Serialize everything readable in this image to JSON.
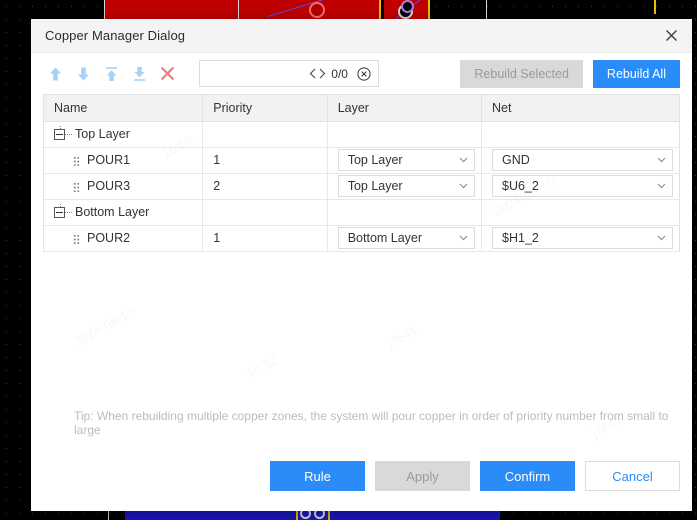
{
  "dialog": {
    "title": "Copper Manager Dialog",
    "close_icon": "close-icon"
  },
  "toolbar": {
    "icons": [
      {
        "name": "move-up-icon",
        "tooltip": "Move Up"
      },
      {
        "name": "move-down-icon",
        "tooltip": "Move Down"
      },
      {
        "name": "move-to-top-icon",
        "tooltip": "Move To Top"
      },
      {
        "name": "move-to-bottom-icon",
        "tooltip": "Move To Bottom"
      },
      {
        "name": "delete-icon",
        "tooltip": "Delete"
      }
    ],
    "search": {
      "value": "",
      "placeholder": "",
      "counter": "0/0",
      "prev_icon": "chevron-left-icon",
      "next_icon": "chevron-right-icon",
      "clear_icon": "clear-circle-icon"
    },
    "rebuild_selected_label": "Rebuild Selected",
    "rebuild_all_label": "Rebuild All"
  },
  "table": {
    "columns": [
      "Name",
      "Priority",
      "Layer",
      "Net"
    ],
    "groups": [
      {
        "name": "Top Layer",
        "expanded": true,
        "rows": [
          {
            "name": "POUR1",
            "priority": "1",
            "layer": "Top Layer",
            "net": "GND"
          },
          {
            "name": "POUR3",
            "priority": "2",
            "layer": "Top Layer",
            "net": "$U6_2"
          }
        ]
      },
      {
        "name": "Bottom Layer",
        "expanded": true,
        "rows": [
          {
            "name": "POUR2",
            "priority": "1",
            "layer": "Bottom Layer",
            "net": "$H1_2"
          }
        ]
      }
    ]
  },
  "tip": "Tip: When rebuilding multiple copper zones, the system will pour copper in order of priority number from small to large",
  "footer": {
    "rule_label": "Rule",
    "apply_label": "Apply",
    "confirm_label": "Confirm",
    "cancel_label": "Cancel"
  },
  "watermarks": [
    "2024-08-10",
    "10:52",
    "j7641",
    "2024-08-10",
    "10:52",
    "j7641"
  ],
  "colors": {
    "accent": "#2a8cf8",
    "disabled": "#d9d9d9",
    "icon_blue": "#a6d2f7",
    "icon_red": "#f08080",
    "tip_text": "#bcbcbc"
  }
}
